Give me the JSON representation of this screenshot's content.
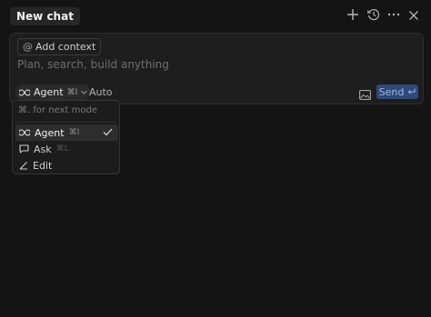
{
  "header": {
    "tab_label": "New chat",
    "icons": [
      "plus-icon",
      "history-icon",
      "more-icon",
      "close-icon"
    ]
  },
  "composer": {
    "context_label": "Add context",
    "placeholder": "Plan, search, build anything",
    "mode": {
      "label": "Agent",
      "shortcut": "⌘I"
    },
    "model": "Auto",
    "send_label": "Send",
    "send_icon": "enter-icon"
  },
  "mode_menu": {
    "hint": "⌘. for next mode",
    "items": [
      {
        "label": "Agent",
        "shortcut": "⌘I",
        "icon": "infinity-icon",
        "selected": true
      },
      {
        "label": "Ask",
        "shortcut": "⌘L",
        "icon": "chat-bubble-icon",
        "selected": false
      },
      {
        "label": "Edit",
        "shortcut": "",
        "icon": "pencil-icon",
        "selected": false
      }
    ]
  },
  "colors": {
    "background": "#141414",
    "panel": "#1e1e1e",
    "send_button": "#2f4a7a",
    "send_text": "#9fb6e2"
  }
}
